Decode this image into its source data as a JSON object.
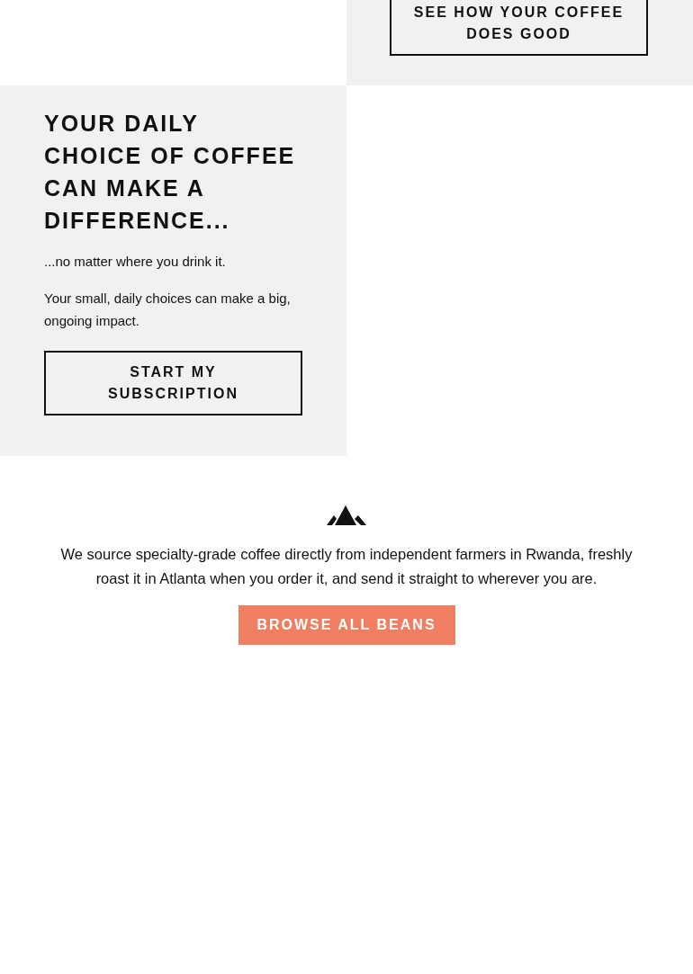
{
  "top_panel": {
    "button": {
      "lines": [
        "SEE HOW YOUR COFFEE",
        "DOES GOOD"
      ]
    }
  },
  "daily_choice": {
    "heading": "YOUR DAILY CHOICE OF COFFEE CAN MAKE A DIFFERENCE...",
    "paragraphs": [
      "...no matter where you drink it.",
      "Your small, daily choices can make a big, ongoing impact."
    ],
    "button": "START MY SUBSCRIPTION"
  },
  "sourcing": {
    "text": "We source specialty-grade coffee directly from independent farmers in Rwanda, freshly roast it in Atlanta when you order it, and send it straight to wherever you are.",
    "button": "BROWSE ALL BEANS"
  }
}
